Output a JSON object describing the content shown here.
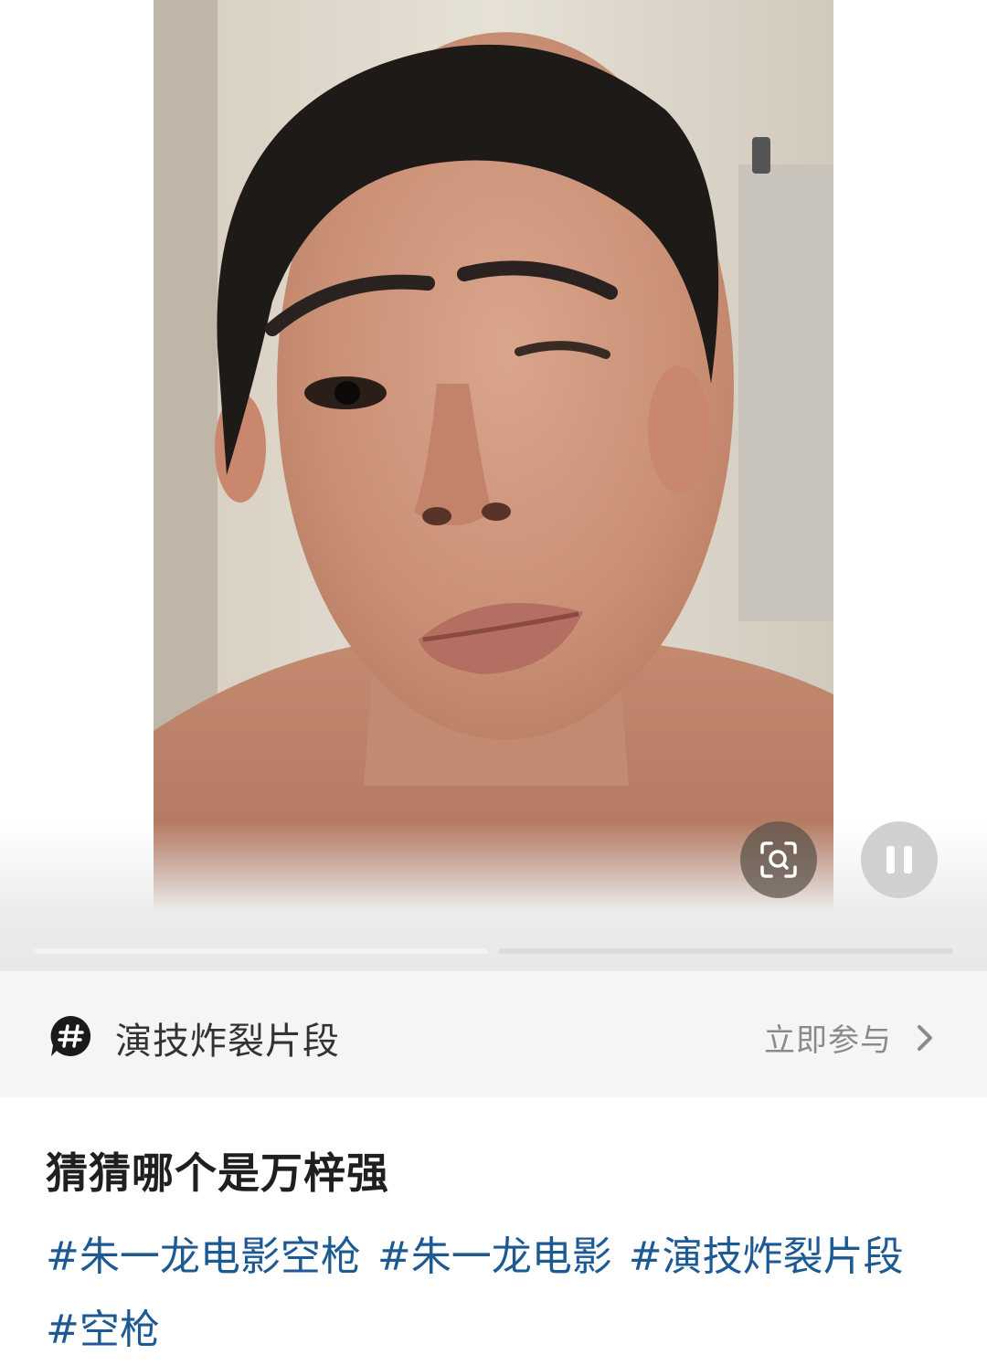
{
  "video": {
    "lens_button": "lens-search-icon",
    "pause_button": "pause-icon",
    "progress": [
      1.0,
      0.0
    ]
  },
  "topic": {
    "icon": "hashtag-bubble-icon",
    "title": "演技炸裂片段",
    "join_label": "立即参与",
    "chevron": "chevron-right-icon"
  },
  "post": {
    "title": "猜猜哪个是万梓强",
    "hashtags": [
      "#朱一龙电影空枪",
      "#朱一龙电影",
      "#演技炸裂片段",
      "#空枪"
    ]
  },
  "colors": {
    "hashtag": "#1d5a94",
    "topic_bar_bg": "#f5f5f5",
    "title_text": "#1f1f1f"
  }
}
